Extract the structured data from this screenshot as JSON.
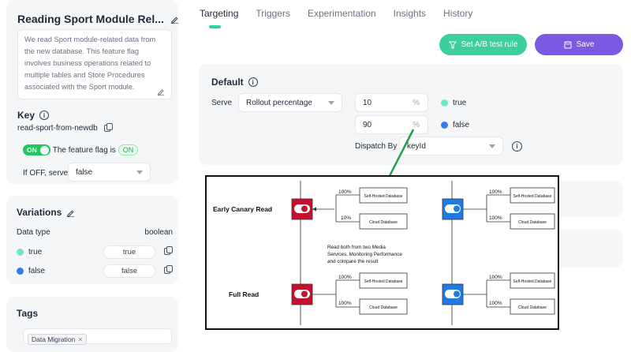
{
  "flag": {
    "title": "Reading Sport Module Rel...",
    "description": "We read Sport module-related data from the new database. This feature flag involves business operations related to multiple tables and Store Procedures associated with the Sport module.",
    "key_heading": "Key",
    "key_value": "read-sport-from-newdb",
    "toggle_label": "ON",
    "status_text": "The feature flag is",
    "status_badge": "ON",
    "off_serve_label": "If OFF, serve",
    "off_serve_value": "false"
  },
  "variations": {
    "heading": "Variations",
    "data_type_label": "Data type",
    "data_type_value": "boolean",
    "items": [
      {
        "name": "true",
        "value": "true",
        "color": "#6ee7c7"
      },
      {
        "name": "false",
        "value": "false",
        "color": "#2f7dea"
      }
    ]
  },
  "tags": {
    "heading": "Tags",
    "items": [
      "Data Migration"
    ]
  },
  "tabs": [
    "Targeting",
    "Triggers",
    "Experimentation",
    "Insights",
    "History"
  ],
  "actions": {
    "ab_test_label": "Set A/B test rule",
    "save_label": "Save"
  },
  "default_rule": {
    "heading": "Default",
    "serve_label": "Serve",
    "serve_value": "Rollout percentage",
    "rollouts": [
      {
        "percent": "10",
        "unit": "%",
        "variation": "true",
        "color": "#6ee7c7"
      },
      {
        "percent": "90",
        "unit": "%",
        "variation": "false",
        "color": "#2f7dea"
      }
    ],
    "dispatch_label": "Dispatch By",
    "dispatch_value": "keyId"
  },
  "diagram": {
    "row1_label": "Early Canary Read",
    "row2_label": "Full Read",
    "note_lines": [
      "Read both from two Media",
      "Services. Monitoring Performance",
      "and compare the result"
    ],
    "self_hosted": "Self-Hosted Database",
    "cloud": "Cloud Database",
    "pct_100": "100%",
    "pct_10": "10%",
    "off_color": "#c8102e",
    "on_color": "#1e7be6"
  },
  "colors": {
    "accent_green": "#2bd6a6",
    "save_purple": "#7b5ae3",
    "ab_green": "#3ecf9e"
  }
}
